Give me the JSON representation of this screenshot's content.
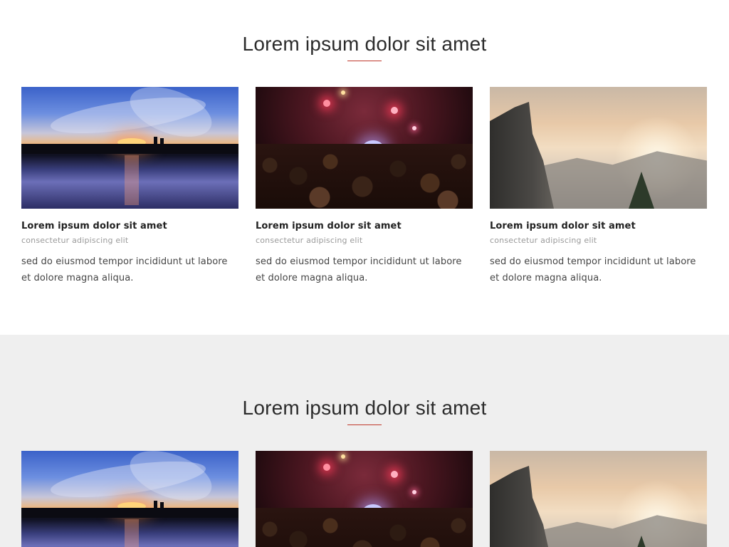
{
  "sections": [
    {
      "heading": "Lorem ipsum dolor sit amet",
      "accent_color": "#c0392b",
      "cards": [
        {
          "image": "sunset-lake-image",
          "title": "Lorem ipsum dolor sit amet",
          "subtitle": "consectetur adipiscing elit",
          "body": "sed do eiusmod tempor incididunt ut labore et dolore magna aliqua."
        },
        {
          "image": "concert-crowd-image",
          "title": "Lorem ipsum dolor sit amet",
          "subtitle": "consectetur adipiscing elit",
          "body": "sed do eiusmod tempor incididunt ut labore et dolore magna aliqua."
        },
        {
          "image": "mountain-cliff-image",
          "title": "Lorem ipsum dolor sit amet",
          "subtitle": "consectetur adipiscing elit",
          "body": "sed do eiusmod tempor incididunt ut labore et dolore magna aliqua."
        }
      ]
    },
    {
      "heading": "Lorem ipsum dolor sit amet",
      "background_color": "#efefef",
      "accent_color": "#c0392b",
      "cards": [
        {
          "image": "sunset-lake-image"
        },
        {
          "image": "concert-crowd-image"
        },
        {
          "image": "mountain-cliff-image"
        }
      ]
    }
  ]
}
